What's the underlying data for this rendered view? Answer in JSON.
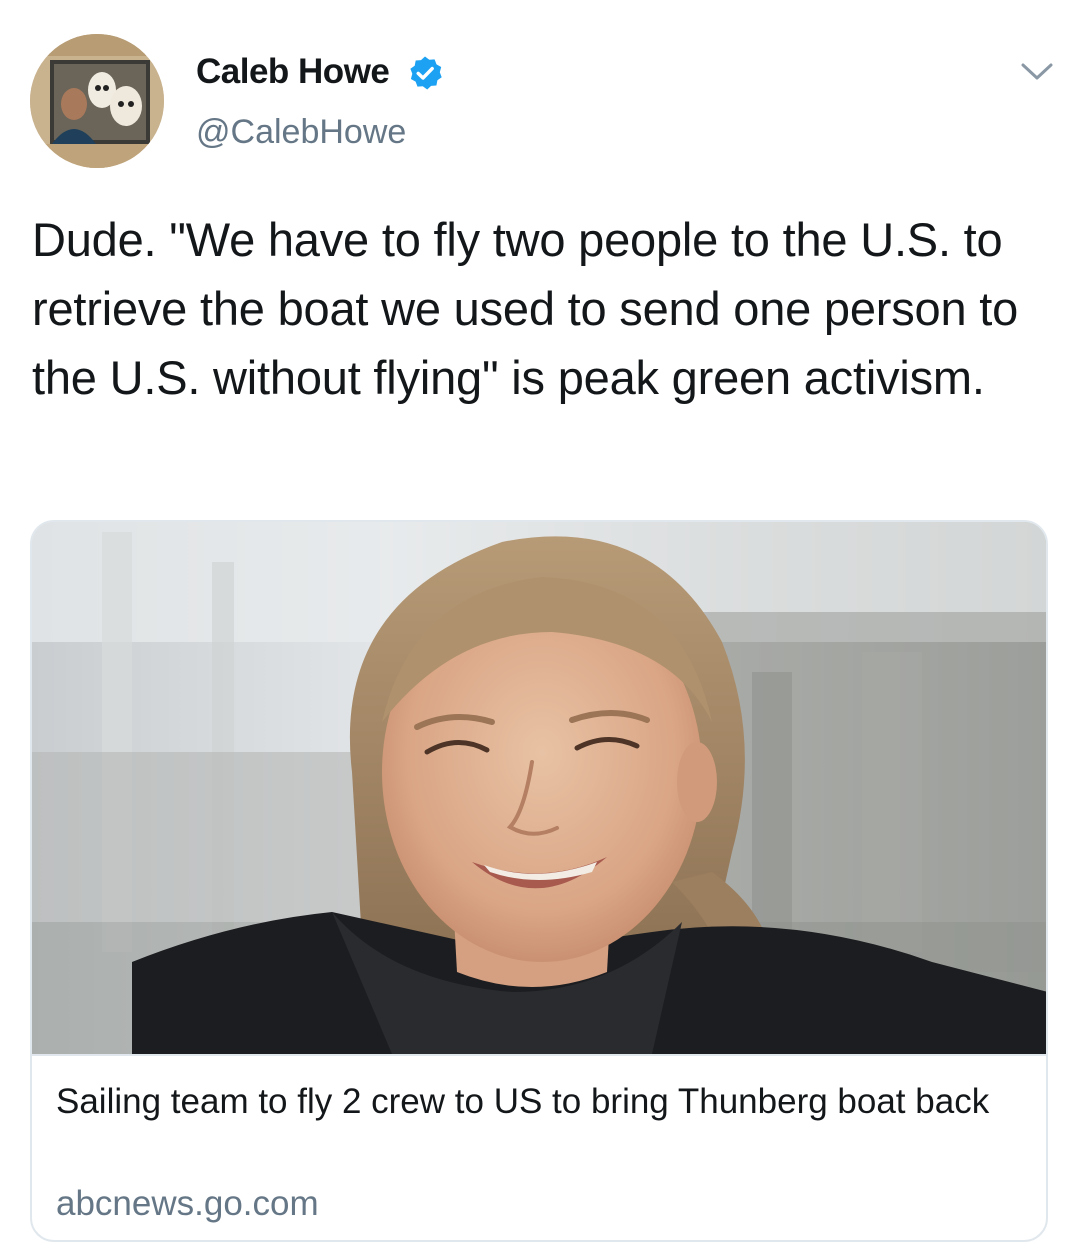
{
  "author": {
    "display_name": "Caleb Howe",
    "handle": "@CalebHowe",
    "verified": true
  },
  "tweet": {
    "text": "Dude. \"We have to fly two people to the U.S. to retrieve the boat we used to send one person to the U.S. without flying\" is peak green activism."
  },
  "link_card": {
    "title": "Sailing team to fly 2 crew to US to bring Thunberg boat back",
    "domain": "abcnews.go.com"
  },
  "icons": {
    "verified": "verified-badge-icon",
    "menu": "chevron-down-icon"
  },
  "colors": {
    "text_primary": "#14171a",
    "text_secondary": "#657786",
    "verified_blue": "#1da1f2",
    "border": "#e1e8ed"
  }
}
